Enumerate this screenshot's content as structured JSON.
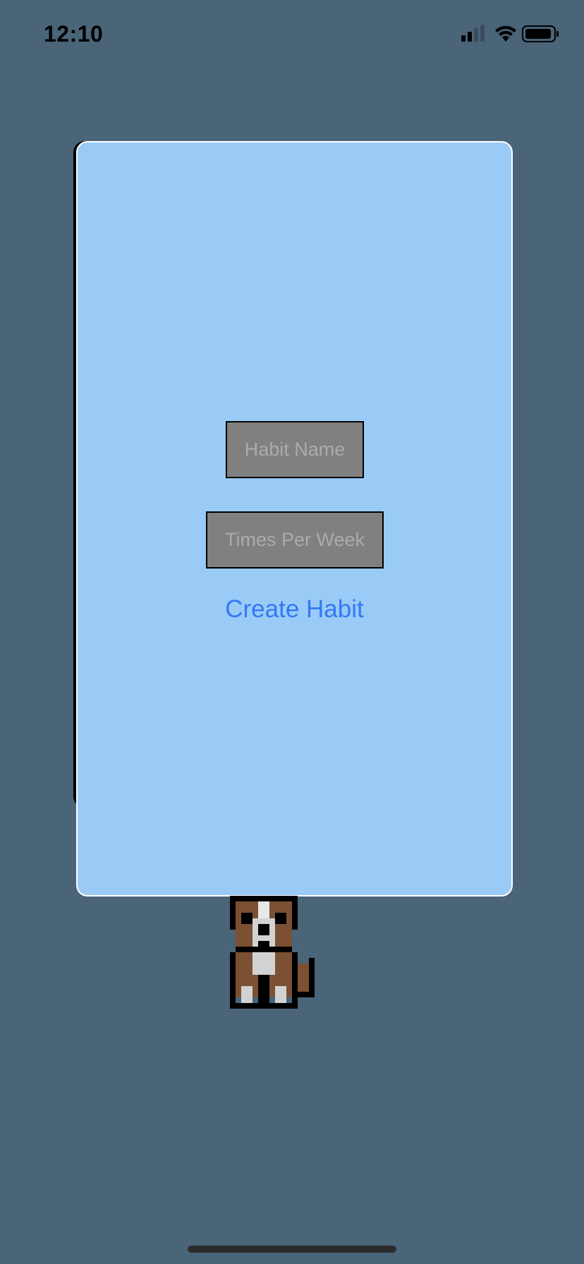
{
  "status_bar": {
    "time": "12:10",
    "icons": [
      "cellular-signal-icon",
      "wifi-icon",
      "battery-icon"
    ]
  },
  "form": {
    "habit_name_placeholder": "Habit Name",
    "times_per_week_placeholder": "Times Per Week",
    "create_button_label": "Create Habit"
  },
  "colors": {
    "background": "#4a6478",
    "card": "#99cbf6",
    "field": "#808080",
    "placeholder_text": "#ababab",
    "button_text": "#3478f6"
  },
  "mascot": {
    "icon": "pixel-dog-icon"
  }
}
